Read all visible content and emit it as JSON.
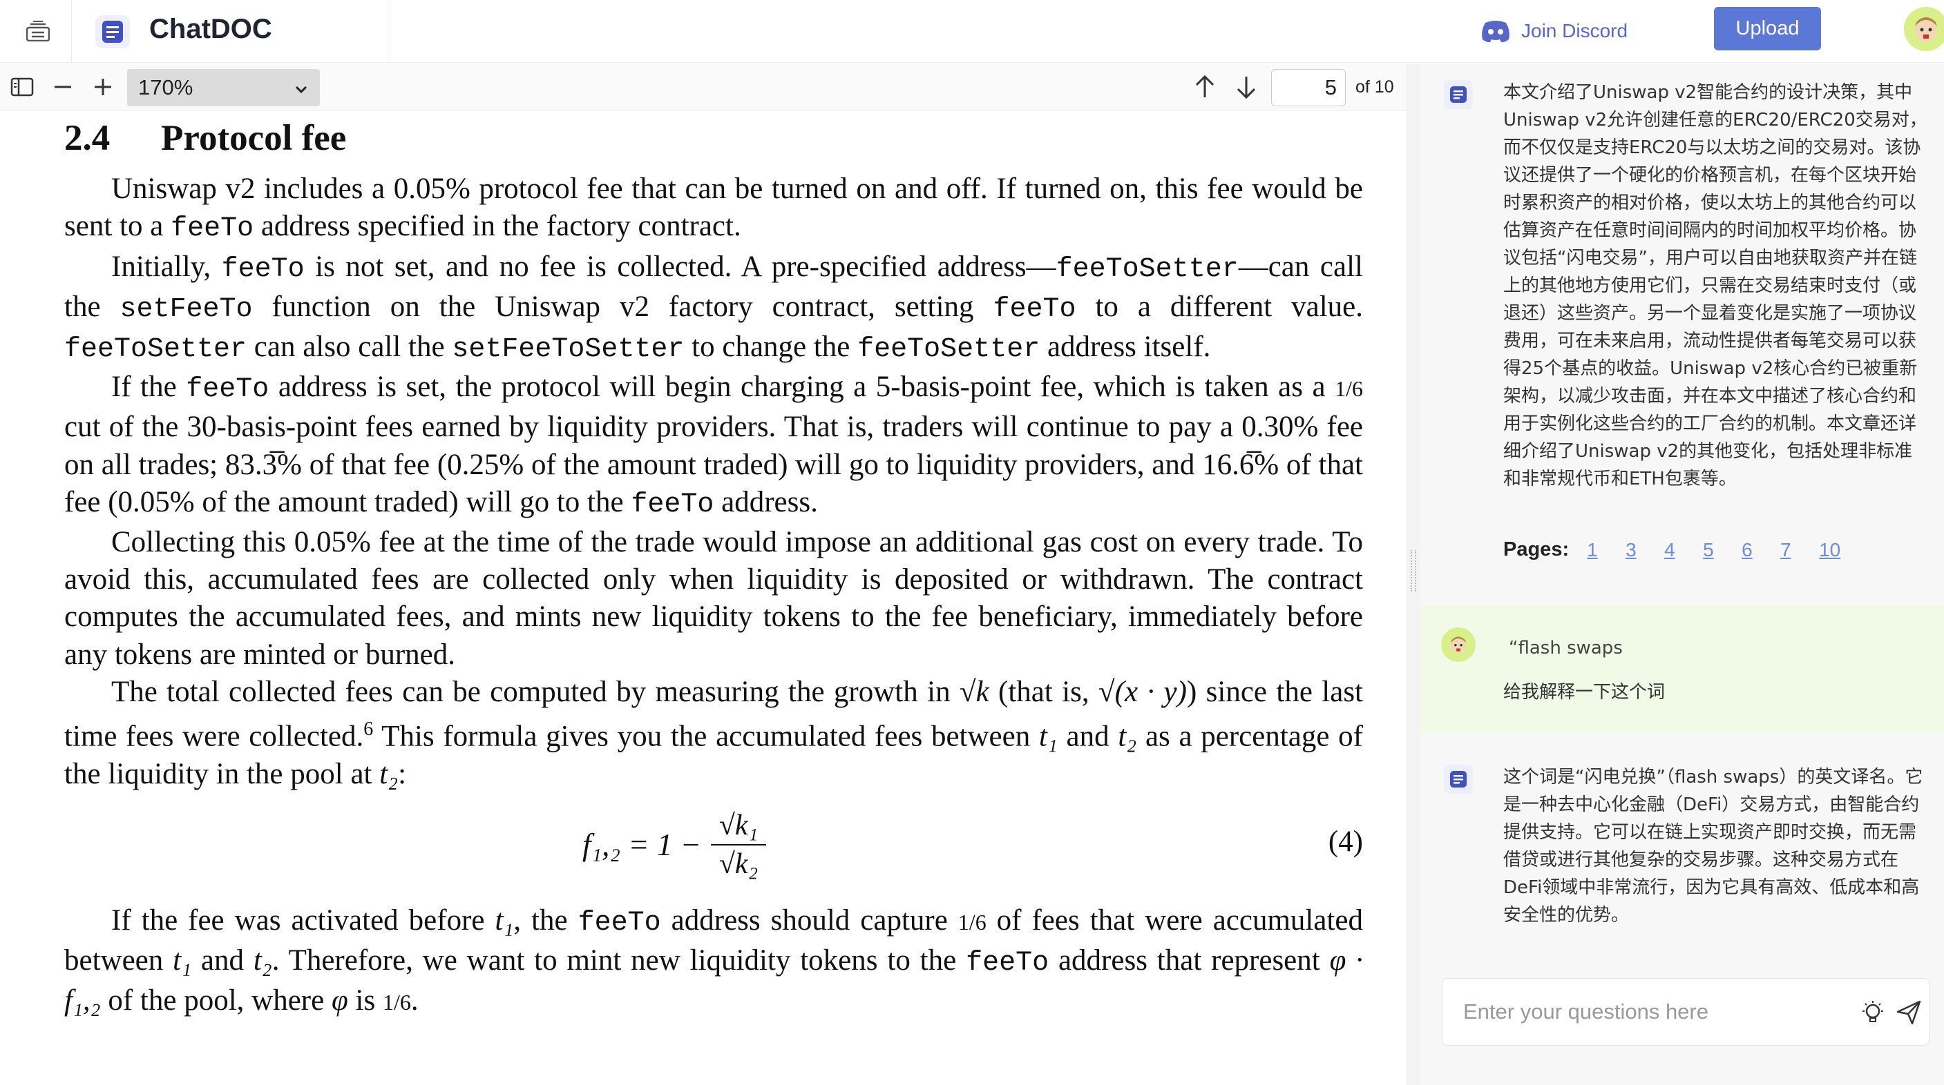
{
  "app": {
    "title": "ChatDOC"
  },
  "header": {
    "discord_label": "Join Discord",
    "upload_label": "Upload"
  },
  "pdf_toolbar": {
    "zoom": "170%",
    "page": "5",
    "page_total": "of 10"
  },
  "pdf": {
    "section_number": "2.4",
    "section_title": "Protocol fee",
    "p1": [
      "Uniswap v2 includes a 0.05% protocol fee that can be turned on and off. If turned on, this fee would be sent to a ",
      "feeTo",
      " address specified in the factory contract."
    ],
    "p2": [
      "Initially, ",
      "feeTo",
      " is not set, and no fee is collected. A pre-specified address—",
      "feeToSetter",
      "—can call the ",
      "setFeeTo",
      " function on the Uniswap v2 factory contract, setting ",
      "feeTo",
      " to a different value. ",
      "feeToSetter",
      " can also call the ",
      "setFeeToSetter",
      " to change the ",
      "feeToSetter",
      " address itself."
    ],
    "p3": [
      "If the ",
      "feeTo",
      " address is set, the protocol will begin charging a 5-basis-point fee, which is taken as a ",
      "1/6",
      " cut of the 30-basis-point fees earned by liquidity providers. That is, traders will continue to pay a 0.30% fee on all trades; 83.3̅% of that fee (0.25% of the amount traded) will go to liquidity providers, and 16.6̅% of that fee (0.05% of the amount traded) will go to the ",
      "feeTo",
      " address."
    ],
    "p4": "Collecting this 0.05% fee at the time of the trade would impose an additional gas cost on every trade. To avoid this, accumulated fees are collected only when liquidity is deposited or withdrawn. The contract computes the accumulated fees, and mints new liquidity tokens to the fee beneficiary, immediately before any tokens are minted or burned.",
    "p5": [
      "The total collected fees can be computed by measuring the growth in ",
      "√k",
      " (that is, ",
      "√(x · y)",
      ") since the last time fees were collected.",
      "6",
      " This formula gives you the accumulated fees between ",
      "t₁",
      " and ",
      "t₂",
      " as a percentage of the liquidity in the pool at ",
      "t₂",
      ":"
    ],
    "equation": {
      "lhs": "f₁,₂ = 1 −",
      "numerator": "√k₁",
      "denominator": "√k₂",
      "number": "(4)"
    },
    "p6": [
      "If the fee was activated before ",
      "t₁",
      ", the ",
      "feeTo",
      " address should capture ",
      "1/6",
      " of fees that were accumulated between ",
      "t₁",
      " and ",
      "t₂",
      ". Therefore, we want to mint new liquidity tokens to the ",
      "feeTo",
      " address that represent ",
      "φ · f₁,₂",
      " of the pool, where ",
      "φ",
      " is ",
      "1/6",
      "."
    ]
  },
  "chat": {
    "summary": "本文介绍了Uniswap v2智能合约的设计决策，其中Uniswap v2允许创建任意的ERC20/ERC20交易对，而不仅仅是支持ERC20与以太坊之间的交易对。该协议还提供了一个硬化的价格预言机，在每个区块开始时累积资产的相对价格，使以太坊上的其他合约可以估算资产在任意时间间隔内的时间加权平均价格。协议包括“闪电交易”，用户可以自由地获取资产并在链上的其他地方使用它们，只需在交易结束时支付（或退还）这些资产。另一个显着变化是实施了一项协议费用，可在未来启用，流动性提供者每笔交易可以获得25个基点的收益。Uniswap v2核心合约已被重新架构，以减少攻击面，并在本文中描述了核心合约和用于实例化这些合约的工厂合约的机制。本文章还详细介绍了Uniswap v2的其他变化，包括处理非标准和非常规代币和ETH包裹等。",
    "pages_label": "Pages:",
    "pages": [
      "1",
      "3",
      "4",
      "5",
      "6",
      "7",
      "10"
    ],
    "user_quote": "“flash swaps",
    "user_question": "给我解释一下这个词",
    "answer": "这个词是“闪电兑换”（flash swaps）的英文译名。它是一种去中心化金融（DeFi）交易方式，由智能合约提供支持。它可以在链上实现资产即时交换，而无需借贷或进行其他复杂的交易步骤。这种交易方式在DeFi领域中非常流行，因为它具有高效、低成本和高安全性的优势。",
    "input_placeholder": "Enter your questions here"
  },
  "colors": {
    "accent": "#5b78d6",
    "discord": "#5865c9",
    "user_msg_bg": "#f1fae7",
    "link": "#6a8fd8"
  }
}
